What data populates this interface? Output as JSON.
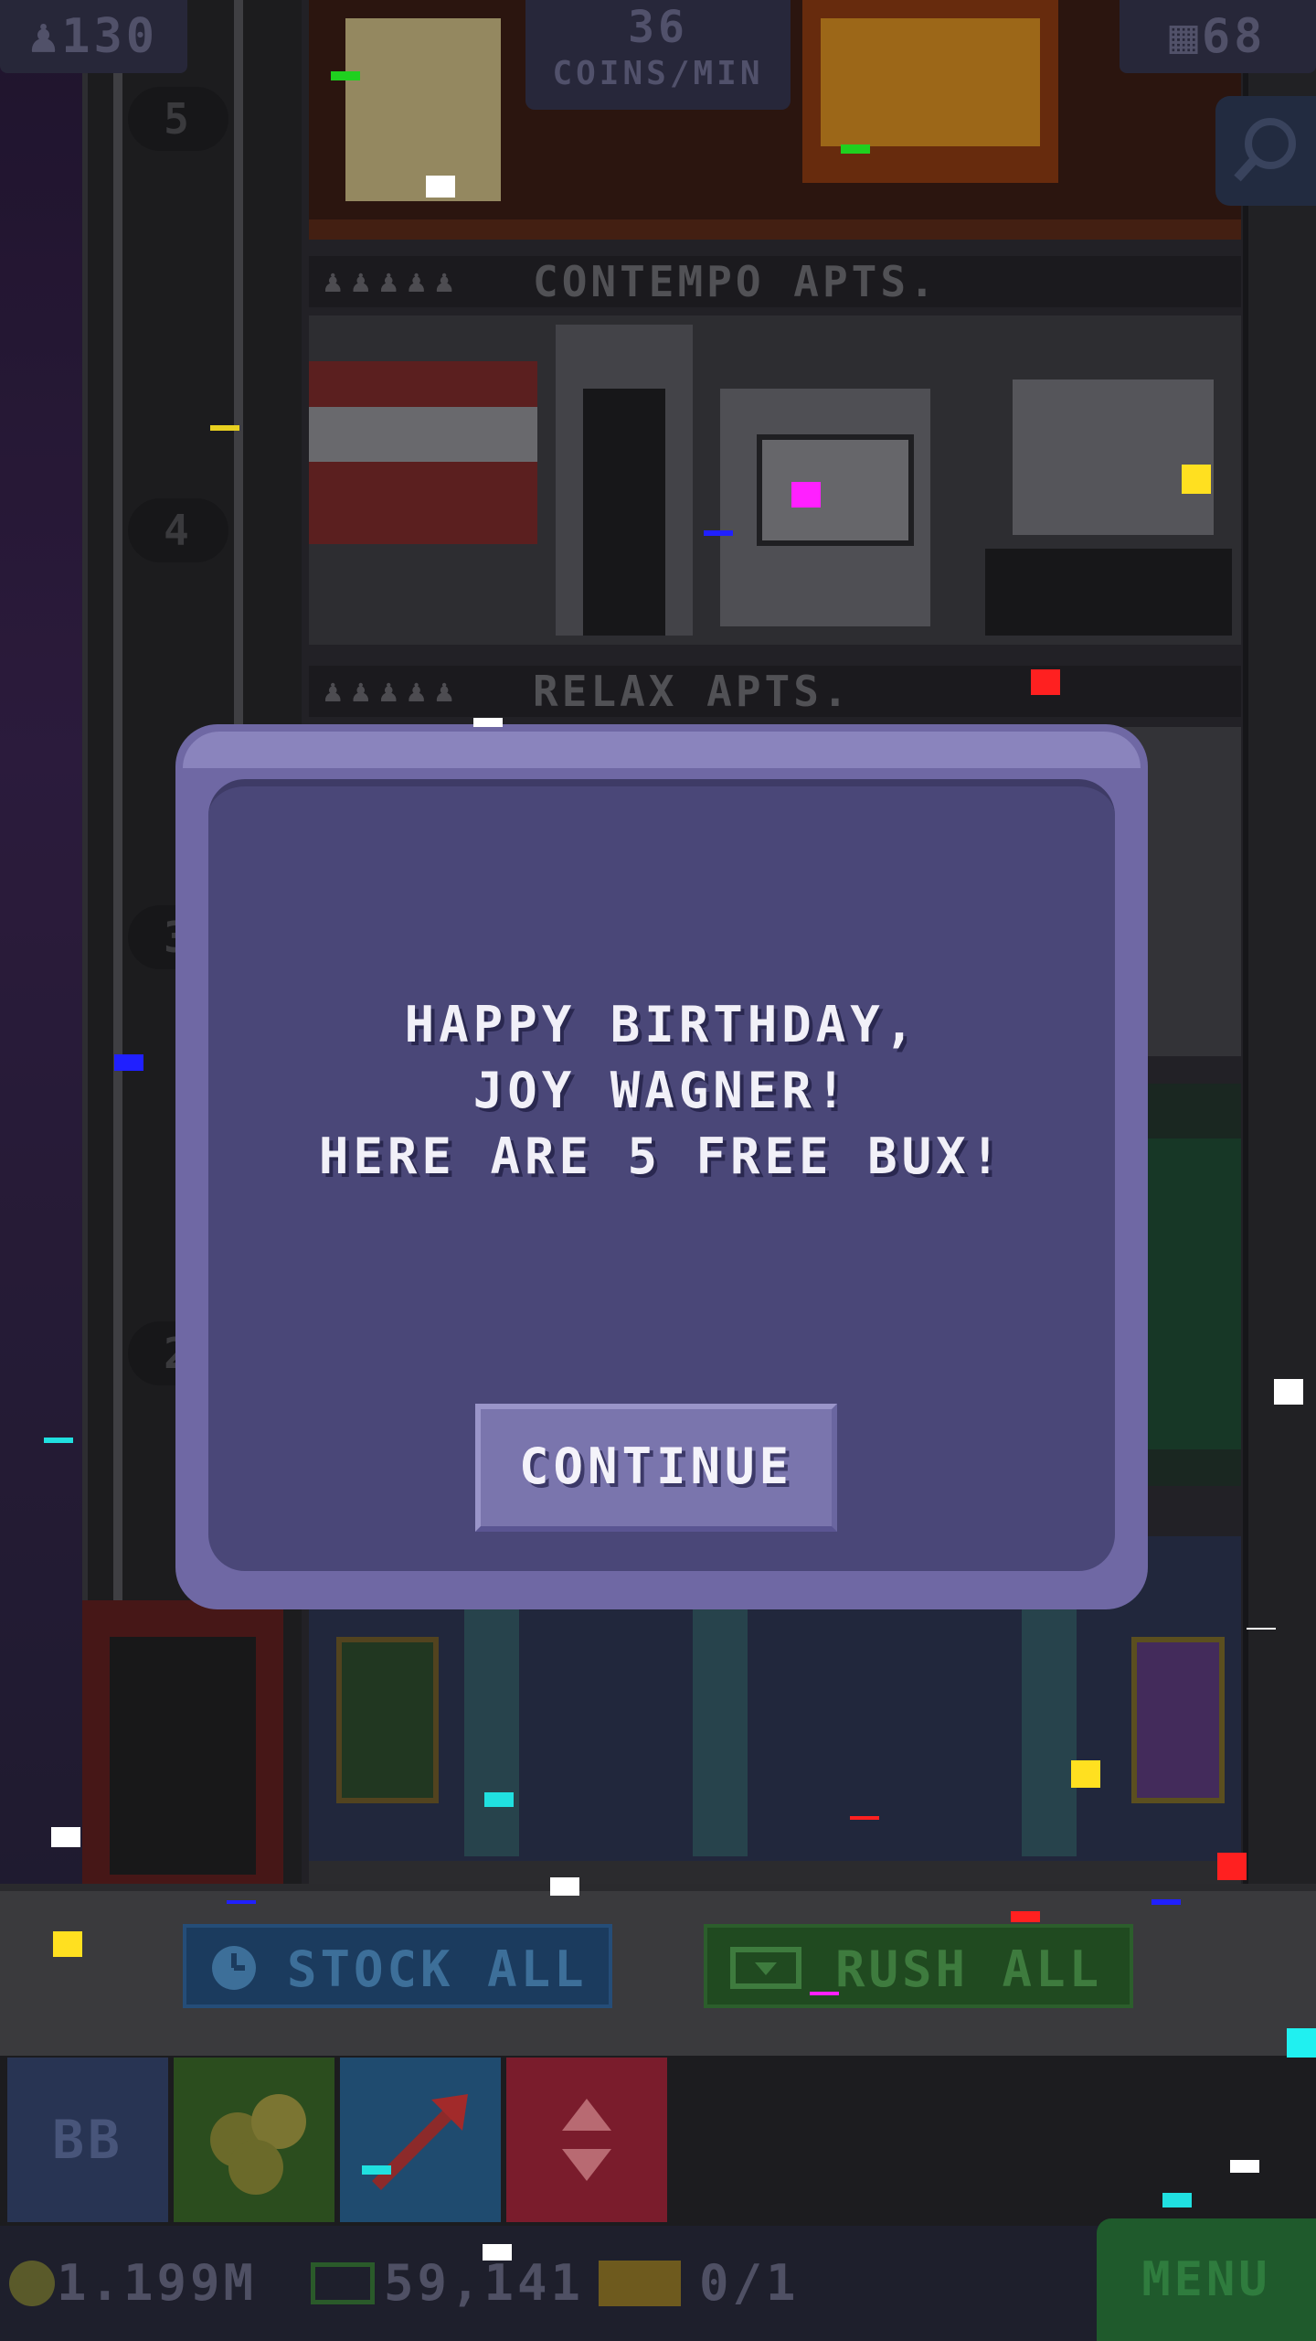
{
  "hud": {
    "population": "130",
    "coins_per_min_value": "36",
    "coins_per_min_unit": "COINS/MIN",
    "floors": "68"
  },
  "floors": [
    {
      "name": "CONTEMPO APTS.",
      "people": "♟♟♟♟♟"
    },
    {
      "name": "RELAX APTS.",
      "people": "♟♟♟♟♟"
    }
  ],
  "elevator_floor_numbers": [
    "5",
    "4",
    "3",
    "2"
  ],
  "dialog": {
    "message": "HAPPY BIRTHDAY,\nJOY WAGNER!\nHERE ARE 5 FREE BUX!",
    "continue_label": "CONTINUE"
  },
  "toolbar": {
    "stock_all_label": "STOCK ALL",
    "rush_all_label": "RUSH ALL"
  },
  "tabs": {
    "bb_label": "BB"
  },
  "status": {
    "coins": "1.199M",
    "bux": "59,141",
    "tickets": "0/1",
    "menu_label": "MENU"
  },
  "colors": {
    "dialog_bg": "#4a4778",
    "dialog_border": "#6f68a4",
    "button": "#7a75ad"
  },
  "icons": [
    "people-icon",
    "floors-icon",
    "search-icon",
    "clock-icon",
    "bux-icon",
    "coins-icon",
    "arrow-icon",
    "elevator-icon",
    "coin-icon",
    "ticket-icon"
  ]
}
